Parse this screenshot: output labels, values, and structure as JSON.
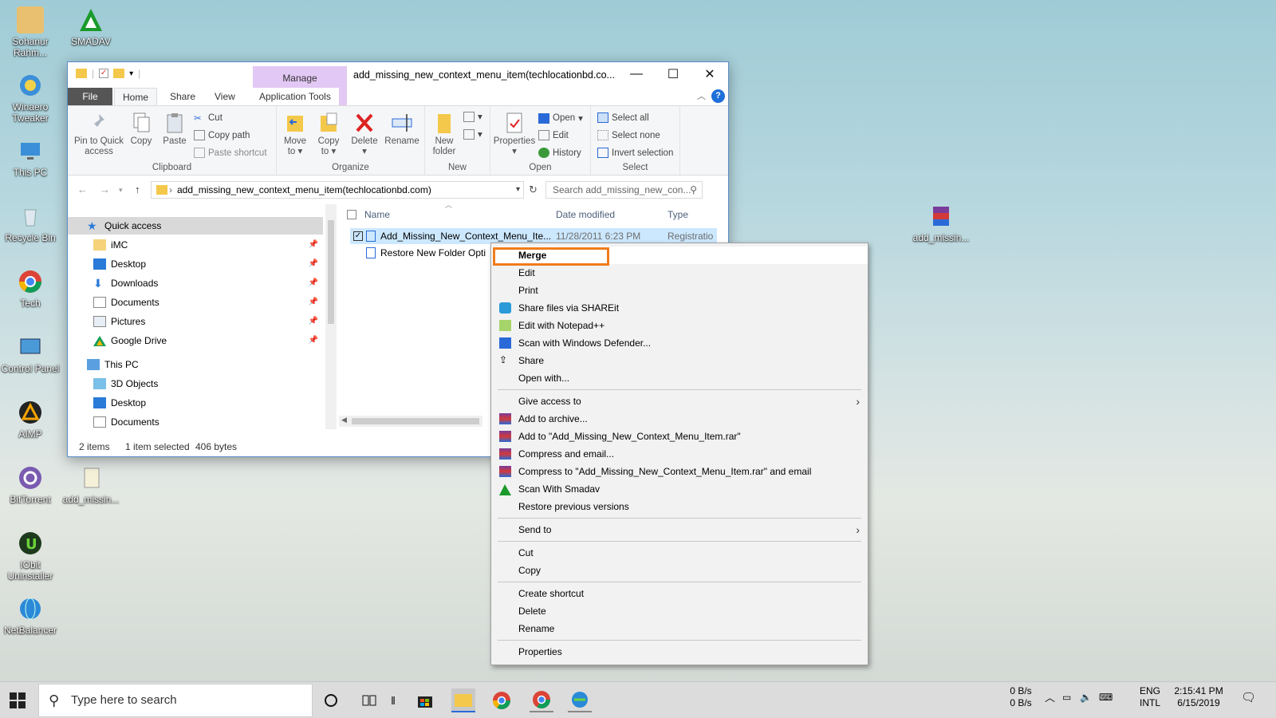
{
  "desktop": {
    "icons": [
      {
        "label": "Sohanur Rahm..."
      },
      {
        "label": "SMADAV"
      },
      {
        "label": "Winaero Tweaker"
      },
      {
        "label": "This PC"
      },
      {
        "label": "Recycle Bin"
      },
      {
        "label": "Tech"
      },
      {
        "label": "Control Panel"
      },
      {
        "label": "AIMP"
      },
      {
        "label": "BitTorrent"
      },
      {
        "label": "add_missin..."
      },
      {
        "label": "IObit Uninstaller"
      },
      {
        "label": "NetBalancer"
      },
      {
        "label": "add_missin..."
      }
    ]
  },
  "explorer": {
    "title": "add_missing_new_context_menu_item(techlocationbd.co...",
    "manage_tab": "Manage",
    "tabs": {
      "file": "File",
      "home": "Home",
      "share": "Share",
      "view": "View",
      "app_tools": "Application Tools"
    },
    "ribbon": {
      "pin": "Pin to Quick access",
      "copy": "Copy",
      "paste": "Paste",
      "cut": "Cut",
      "copy_path": "Copy path",
      "paste_shortcut": "Paste shortcut",
      "clipboard": "Clipboard",
      "move_to": "Move to",
      "copy_to": "Copy to",
      "delete": "Delete",
      "rename": "Rename",
      "organize": "Organize",
      "new_folder": "New folder",
      "new": "New",
      "properties": "Properties",
      "open_btn": "Open",
      "edit": "Edit",
      "history": "History",
      "open_group": "Open",
      "select_all": "Select all",
      "select_none": "Select none",
      "invert_selection": "Invert selection",
      "select_group": "Select"
    },
    "address": "add_missing_new_context_menu_item(techlocationbd.com)",
    "search_placeholder": "Search add_missing_new_con...",
    "nav": {
      "quick_access": "Quick access",
      "items": [
        "iMC",
        "Desktop",
        "Downloads",
        "Documents",
        "Pictures",
        "Google Drive"
      ],
      "this_pc": "This PC",
      "pc_items": [
        "3D Objects",
        "Desktop",
        "Documents"
      ]
    },
    "columns": {
      "name": "Name",
      "date": "Date modified",
      "type": "Type"
    },
    "files": [
      {
        "name": "Add_Missing_New_Context_Menu_Ite...",
        "date": "11/28/2011 6:23 PM",
        "type": "Registratio"
      },
      {
        "name": "Restore New Folder Opti"
      }
    ],
    "status": {
      "items": "2 items",
      "selected": "1 item selected",
      "size": "406 bytes"
    }
  },
  "context_menu": {
    "merge": "Merge",
    "edit": "Edit",
    "print": "Print",
    "shareit": "Share files via SHAREit",
    "notepad": "Edit with Notepad++",
    "defender": "Scan with Windows Defender...",
    "share": "Share",
    "open_with": "Open with...",
    "give_access": "Give access to",
    "add_archive": "Add to archive...",
    "add_rar": "Add to \"Add_Missing_New_Context_Menu_Item.rar\"",
    "compress_email": "Compress and email...",
    "compress_rar_email": "Compress to \"Add_Missing_New_Context_Menu_Item.rar\" and email",
    "smadav": "Scan With Smadav",
    "restore": "Restore previous versions",
    "send_to": "Send to",
    "cut": "Cut",
    "copy": "Copy",
    "create_shortcut": "Create shortcut",
    "delete": "Delete",
    "rename": "Rename",
    "properties": "Properties"
  },
  "taskbar": {
    "search_placeholder": "Type here to search",
    "net_up": "0 B/s",
    "net_down": "0 B/s",
    "lang1": "ENG",
    "lang2": "INTL",
    "time": "2:15:41 PM",
    "date": "6/15/2019"
  },
  "colors": {
    "highlight": "#f07c1a",
    "manage_tab": "#e2c8f5",
    "selection": "#cce8ff"
  }
}
